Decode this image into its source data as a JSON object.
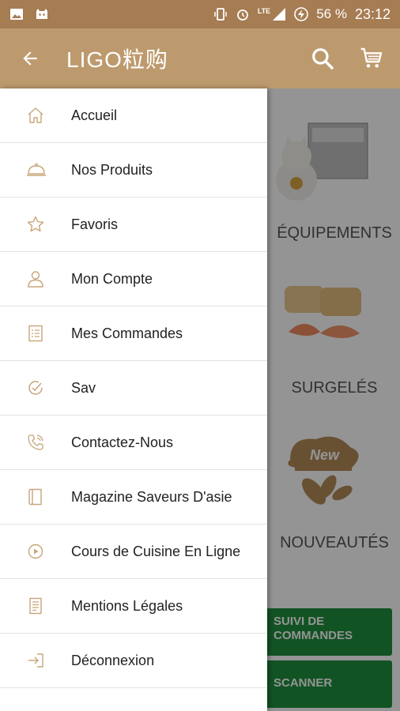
{
  "status_bar": {
    "battery": "56 %",
    "time": "23:12",
    "network": "LTE"
  },
  "app_bar": {
    "logo": "LIGO粒购",
    "back_icon": "arrow-left-icon",
    "search_icon": "search-icon",
    "cart_icon": "cart-icon"
  },
  "colors": {
    "status_bar": "#a67c52",
    "app_bar": "#bd9a6e",
    "icon_tint": "#c8a57a",
    "button_green": "#1f8f3f"
  },
  "menu": {
    "items": [
      {
        "label": "Accueil",
        "icon": "home-icon"
      },
      {
        "label": "Nos Produits",
        "icon": "cloche-icon"
      },
      {
        "label": "Favoris",
        "icon": "star-icon"
      },
      {
        "label": "Mon Compte",
        "icon": "user-icon"
      },
      {
        "label": "Mes Commandes",
        "icon": "list-icon"
      },
      {
        "label": "Sav",
        "icon": "support-icon"
      },
      {
        "label": "Contactez-Nous",
        "icon": "phone-icon"
      },
      {
        "label": "Magazine Saveurs D'asie",
        "icon": "magazine-icon"
      },
      {
        "label": "Cours de Cuisine En Ligne",
        "icon": "play-icon"
      },
      {
        "label": "Mentions Légales",
        "icon": "document-icon"
      },
      {
        "label": "Déconnexion",
        "icon": "logout-icon"
      }
    ]
  },
  "background": {
    "categories": [
      "ÉQUIPEMENTS",
      "SURGELÉS",
      "NOUVEAUTÉS"
    ],
    "new_badge": "New",
    "buttons": [
      "SUIVI DE COMMANDES",
      "SCANNER"
    ]
  }
}
